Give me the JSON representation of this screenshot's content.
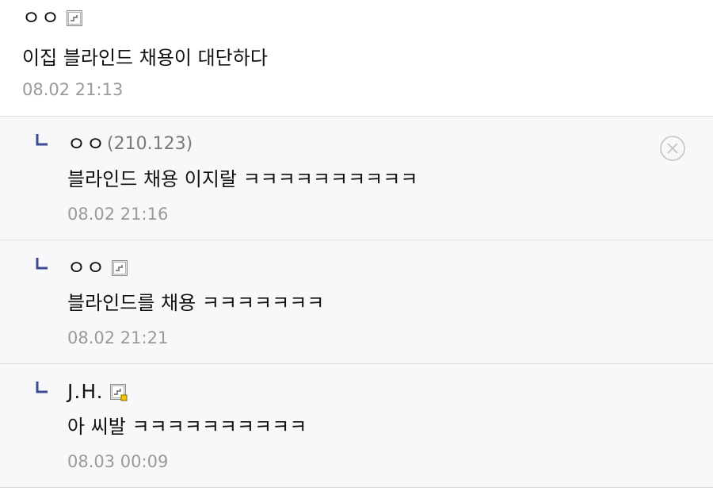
{
  "comments": [
    {
      "nickname": "ㅇㅇ",
      "ip": "",
      "icon": "gallog-icon",
      "text": "이집 블라인드 채용이 대단하다",
      "date": "08.02 21:13"
    }
  ],
  "replies": [
    {
      "nickname": "ㅇㅇ",
      "ip": "(210.123)",
      "icon": "",
      "text": "블라인드 채용 이지랄 ㅋㅋㅋㅋㅋㅋㅋㅋㅋㅋ",
      "date": "08.02 21:16",
      "deletable": true
    },
    {
      "nickname": "ㅇㅇ",
      "ip": "",
      "icon": "gallog-icon",
      "text": "블라인드를 채용 ㅋㅋㅋㅋㅋㅋㅋ",
      "date": "08.02 21:21",
      "deletable": false
    },
    {
      "nickname": "J.H.",
      "ip": "",
      "icon": "gallog-fixed-icon",
      "text": "아 씨발 ㅋㅋㅋㅋㅋㅋㅋㅋㅋㅋ",
      "date": "08.03 00:09",
      "deletable": false
    }
  ],
  "icons": {
    "reply_arrow": "reply-arrow-icon",
    "delete": "delete-circle-x-icon"
  },
  "colors": {
    "reply_arrow": "#3b4a8c",
    "date": "#9a9a9a",
    "ip": "#7a7a7a",
    "reply_background": "#f8f8fb",
    "divider": "#dcdcdc",
    "fixed_badge": "#f2c500"
  }
}
